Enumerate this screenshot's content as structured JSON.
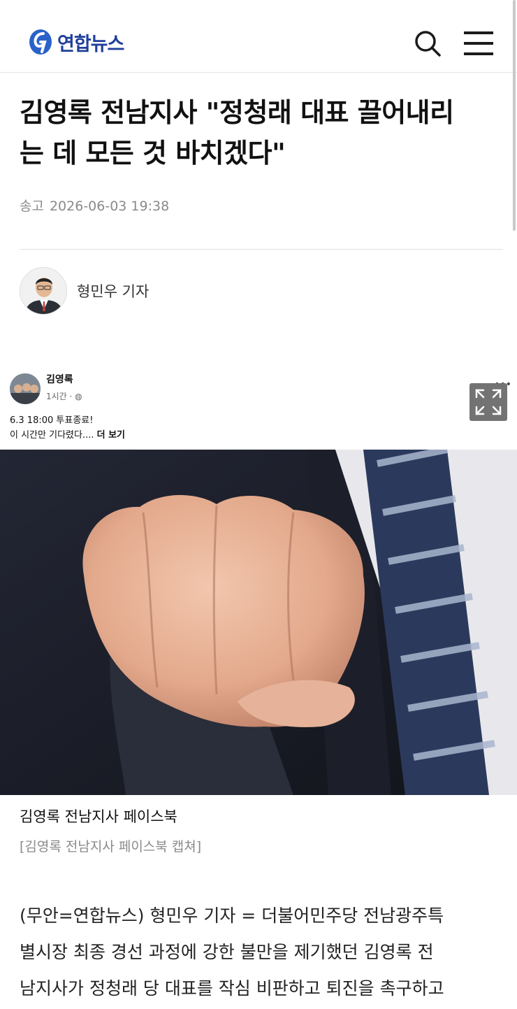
{
  "header": {
    "logo_text": "연합뉴스",
    "search_icon": "search-icon",
    "menu_icon": "hamburger-menu-icon",
    "brand_color": "#1f5fbf"
  },
  "article": {
    "title_line1": "김영록 전남지사 \"정청래 대표 끌어내리",
    "title_line2": "는 데 모든 것 바치겠다\"",
    "meta_label": "송고",
    "meta_datetime": "2026-06-03 19:38",
    "reporter": "형민우 기자"
  },
  "facebook_capture": {
    "name": "김영록",
    "time": "1시간 · ",
    "line1": "6.3 18:00  투표종료!",
    "line2_text": "이 시간만 기다렸다.... ",
    "line2_more": "더 보기",
    "more_icon": "ellipsis-icon",
    "globe_icon": "globe-icon"
  },
  "image": {
    "expand_icon": "expand-icon",
    "caption": "김영록 전남지사 페이스북",
    "credit": "[김영록 전남지사 페이스북 캡쳐]"
  },
  "body": {
    "line1": "(무안=연합뉴스) 형민우 기자 = 더불어민주당 전남광주특",
    "line2": "별시장 최종 경선 과정에 강한 불만을 제기했던 김영록 전",
    "line3": "남지사가 정청래 당 대표를 작심 비판하고 퇴진을 촉구하고"
  }
}
